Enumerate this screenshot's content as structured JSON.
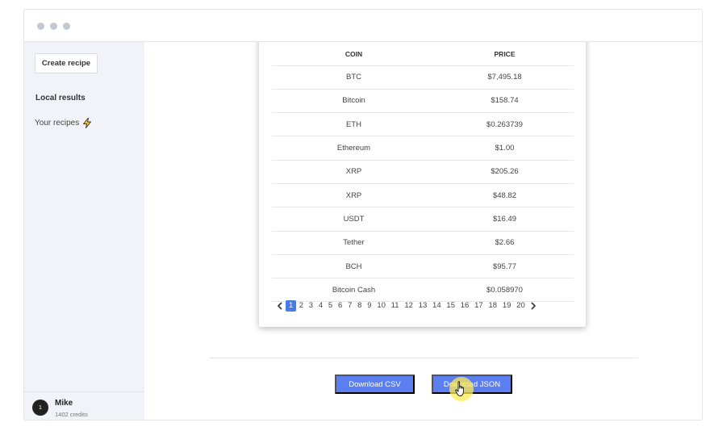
{
  "sidebar": {
    "create_button": "Create recipe",
    "local_results": "Local results",
    "your_recipes": "Your recipes",
    "your_recipes_icon": "lightning-bolt-icon"
  },
  "user": {
    "avatar_text": "1",
    "name": "Mike",
    "credits": "1402 credits"
  },
  "table": {
    "columns": [
      "COIN",
      "PRICE"
    ],
    "rows": [
      [
        "BTC",
        "$7,495.18"
      ],
      [
        "Bitcoin",
        "$158.74"
      ],
      [
        "ETH",
        "$0.263739"
      ],
      [
        "Ethereum",
        "$1.00"
      ],
      [
        "XRP",
        "$205.26"
      ],
      [
        "XRP",
        "$48.82"
      ],
      [
        "USDT",
        "$16.49"
      ],
      [
        "Tether",
        "$2.66"
      ],
      [
        "BCH",
        "$95.77"
      ],
      [
        "Bitcoin Cash",
        "$0.058970"
      ]
    ]
  },
  "pagination": {
    "pages": [
      "1",
      "2",
      "3",
      "4",
      "5",
      "6",
      "7",
      "8",
      "9",
      "10",
      "11",
      "12",
      "13",
      "14",
      "15",
      "16",
      "17",
      "18",
      "19",
      "20"
    ],
    "current": "1"
  },
  "actions": {
    "download_csv": "Download CSV",
    "download_json": "Download JSON"
  },
  "colors": {
    "accent": "#5b7ef0",
    "active_page": "#4a79e8",
    "sidebar_bg": "#f1f3f8",
    "cursor_highlight": "#ffe950"
  }
}
